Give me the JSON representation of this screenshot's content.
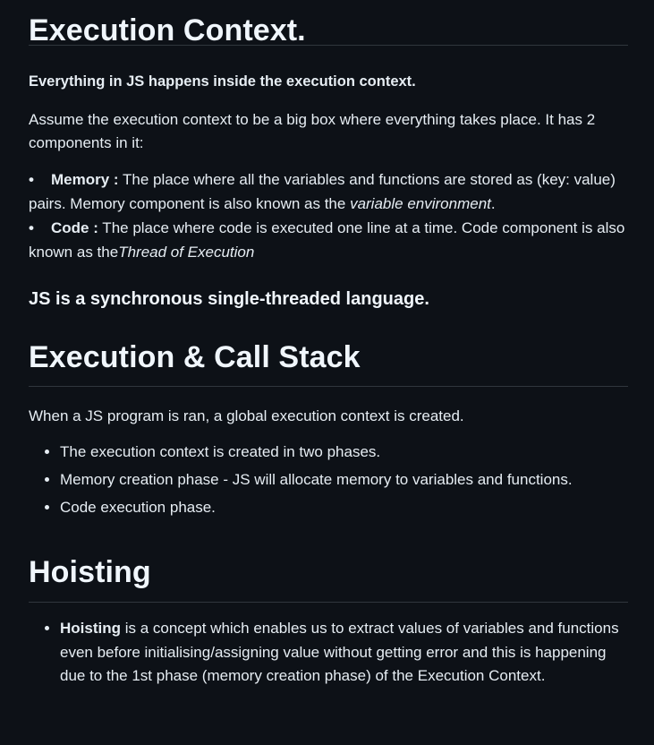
{
  "section1": {
    "heading": "Execution Context.",
    "bold_line": "Everything in JS happens inside the execution context.",
    "paragraph": "Assume the execution context to be a big box where everything takes place. It has 2 components in it:",
    "items": [
      {
        "bullet": "•",
        "term": "Memory :",
        "text": " The place where all the variables and functions are stored as (key: value) pairs. Memory component is also known as the ",
        "italic": "variable environment",
        "after": "."
      },
      {
        "bullet": "•",
        "term": "Code :",
        "text": " The place where code is executed one line at a time. Code component is also known as the",
        "italic": "Thread of Execution",
        "after": ""
      }
    ],
    "subheading": "JS is a synchronous single-threaded language."
  },
  "section2": {
    "heading": "Execution & Call Stack",
    "intro": "When a JS program is ran, a global execution context is created.",
    "bullets": [
      "The execution context is created in two phases.",
      "Memory creation phase - JS will allocate memory to variables and functions.",
      "Code execution phase."
    ]
  },
  "section3": {
    "heading": "Hoisting",
    "bullet_term": "Hoisting",
    "bullet_text": " is a concept which enables us to extract values of variables and functions even before initialising/assigning value without getting error and this is happening due to the 1st phase (memory creation phase) of the Execution Context."
  }
}
